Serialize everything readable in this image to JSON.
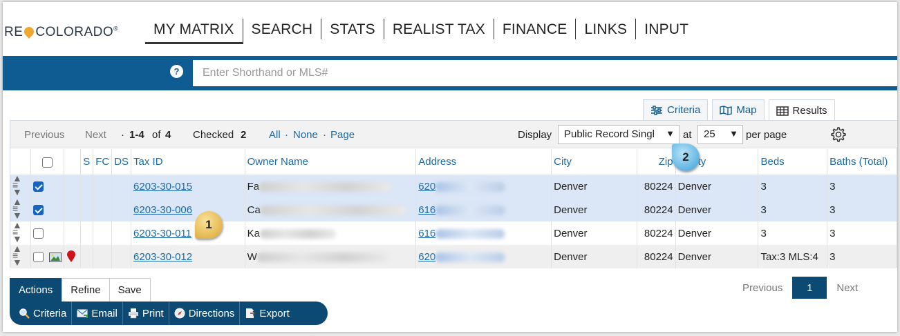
{
  "brand": {
    "logo_left": "RE",
    "logo_right": "COLORADO",
    "logo_mark": "®"
  },
  "nav": {
    "items": [
      "MY MATRIX",
      "SEARCH",
      "STATS",
      "REALIST TAX",
      "FINANCE",
      "LINKS",
      "INPUT"
    ],
    "active": "MY MATRIX"
  },
  "search": {
    "help": "?",
    "placeholder": "Enter Shorthand or MLS#"
  },
  "view_tabs": {
    "criteria": "Criteria",
    "map": "Map",
    "results": "Results"
  },
  "toolbar": {
    "previous": "Previous",
    "next": "Next",
    "dot": "·",
    "range": "1-4",
    "of": "of",
    "total": "4",
    "checked_label": "Checked",
    "checked_count": "2",
    "all": "All",
    "none": "None",
    "page": "Page",
    "display_label": "Display",
    "display_value": "Public Record Singl",
    "at": "at",
    "per_page_value": "25",
    "per_page": "per page"
  },
  "table": {
    "headers": {
      "s": "S",
      "fc": "FC",
      "ds": "DS",
      "tax_id": "Tax ID",
      "owner": "Owner Name",
      "address": "Address",
      "city": "City",
      "zip": "Zip",
      "city2": "ty",
      "beds": "Beds",
      "baths": "Baths (Total)"
    },
    "rows": [
      {
        "checked": true,
        "tax_id": "6203-30-015",
        "owner": "Fa",
        "address": "620",
        "city": "Denver",
        "zip": "80224",
        "city2": "Denver",
        "beds": "3",
        "baths": "3"
      },
      {
        "checked": true,
        "tax_id": "6203-30-006",
        "owner": "Ca",
        "address": "616",
        "city": "Denver",
        "zip": "80224",
        "city2": "Denver",
        "beds": "3",
        "baths": "3"
      },
      {
        "checked": false,
        "tax_id": "6203-30-011",
        "owner": "Ka",
        "address": "616",
        "city": "Denver",
        "zip": "80224",
        "city2": "Denver",
        "beds": "3",
        "baths": "3"
      },
      {
        "checked": false,
        "tax_id": "6203-30-012",
        "owner": "W",
        "address": "620",
        "city": "Denver",
        "zip": "80224",
        "city2": "Denver",
        "beds": "Tax:3 MLS:4",
        "baths": "3"
      }
    ]
  },
  "callouts": {
    "one": "1",
    "two": "2"
  },
  "action_tabs": [
    "Actions",
    "Refine",
    "Save"
  ],
  "actions": [
    "Criteria",
    "Email",
    "Print",
    "Directions",
    "Export"
  ],
  "pager": {
    "previous": "Previous",
    "current": "1",
    "next": "Next"
  },
  "colors": {
    "brand_blue": "#0f5c92",
    "dark_blue": "#0d4a73",
    "link": "#1b6aa5",
    "selected_row": "#dbe6f6"
  }
}
